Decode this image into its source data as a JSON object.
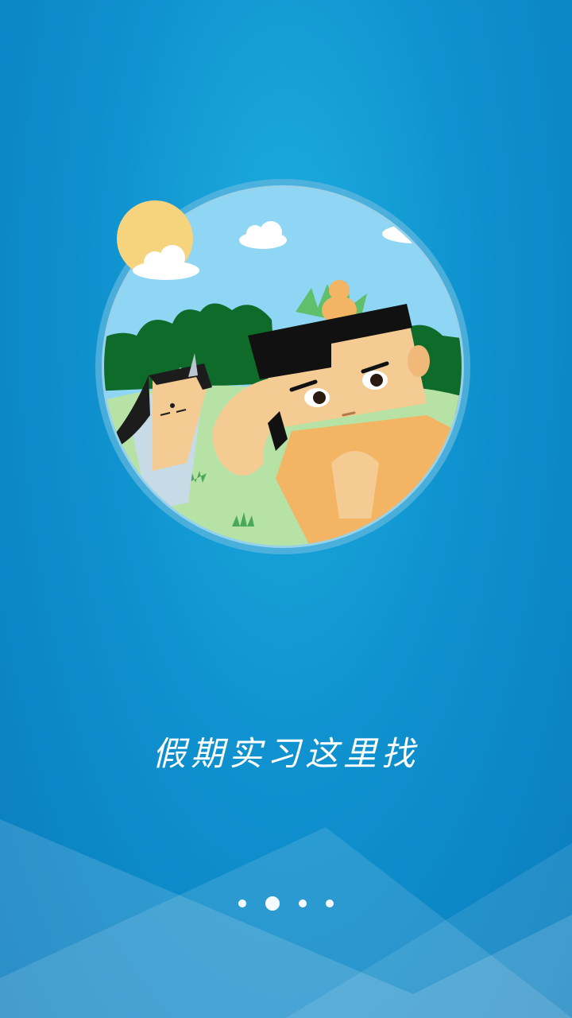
{
  "onboarding": {
    "slogan": "假期实习这里找",
    "illustration_icon": "cartoon-heroes-illustration",
    "pager": {
      "total_pages": 4,
      "active_index": 1
    }
  },
  "colors": {
    "background_top": "#1eaee0",
    "background_bottom": "#0a7cbd",
    "sky": "#8fd6f5",
    "grass": "#b7e2a6",
    "trees": "#0f6b2a",
    "sun": "#f6d37d",
    "skin": "#f4cb93",
    "robe": "#f3b463",
    "dot": "#ffffff"
  }
}
